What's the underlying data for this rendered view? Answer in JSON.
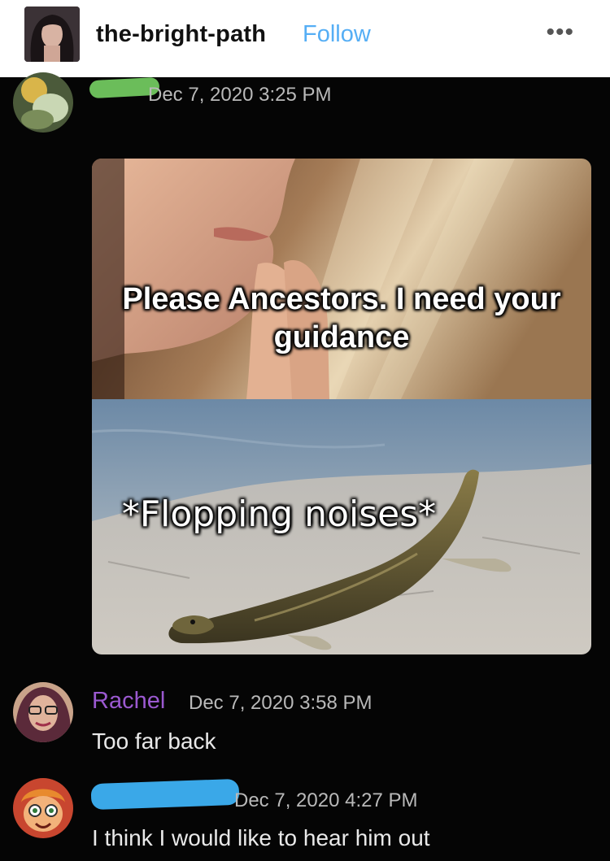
{
  "header": {
    "blog_name": "the-bright-path",
    "follow_label": "Follow",
    "more_icon": "ellipsis-icon",
    "more_glyph": "•••"
  },
  "messages": [
    {
      "username_redacted": true,
      "redaction_color": "#6bbd5a",
      "timestamp": "Dec 7, 2020 3:25 PM",
      "attachment": {
        "top_caption": "Please Ancestors. I need your guidance",
        "bottom_caption": "*Flopping noises*"
      }
    },
    {
      "username": "Rachel",
      "username_color": "#9b59d0",
      "timestamp": "Dec 7, 2020 3:58 PM",
      "text": "Too far back"
    },
    {
      "username_redacted": true,
      "redaction_color": "#3aa8e8",
      "timestamp": "Dec 7, 2020 4:27 PM",
      "text": "I think I would like to hear him out"
    }
  ]
}
